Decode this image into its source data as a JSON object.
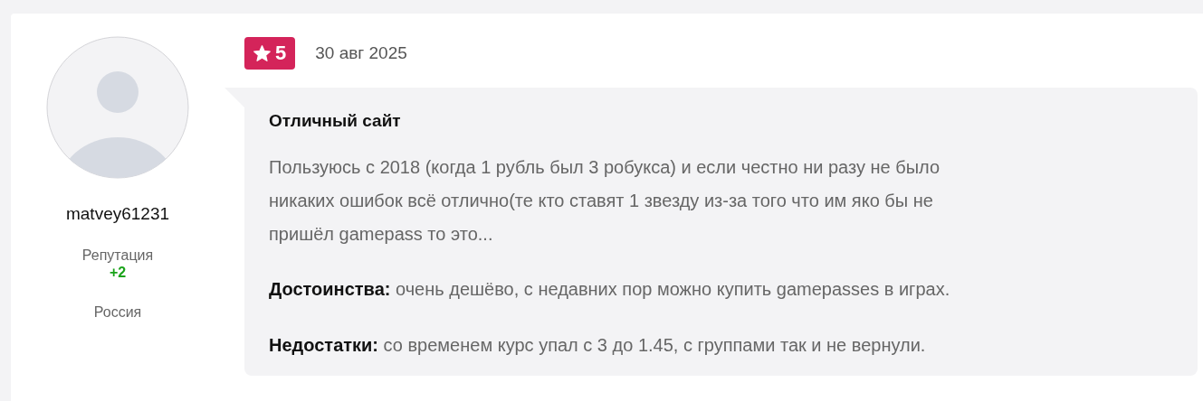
{
  "author": {
    "name": "matvey61231",
    "reputation_label": "Репутация",
    "reputation": "+2",
    "country": "Россия"
  },
  "review": {
    "rating": "5",
    "date": "30 авг 2025",
    "title": "Отличный сайт",
    "body": "Пользуюсь с 2018 (когда 1 рубль был 3 робукса) и если честно ни разу не было никаких ошибок всё отлично(те кто ставят 1 звезду из-за того что им яко бы не пришёл gamepass то это...",
    "sections": [
      {
        "text": "**Достоинства:** очень дешёво, с недавних пор можно купить gamepasses в играх."
      },
      {
        "text": "**Недостатки:** со временем курс упал с 3 до 1.45, с группами так и не вернули."
      }
    ]
  }
}
